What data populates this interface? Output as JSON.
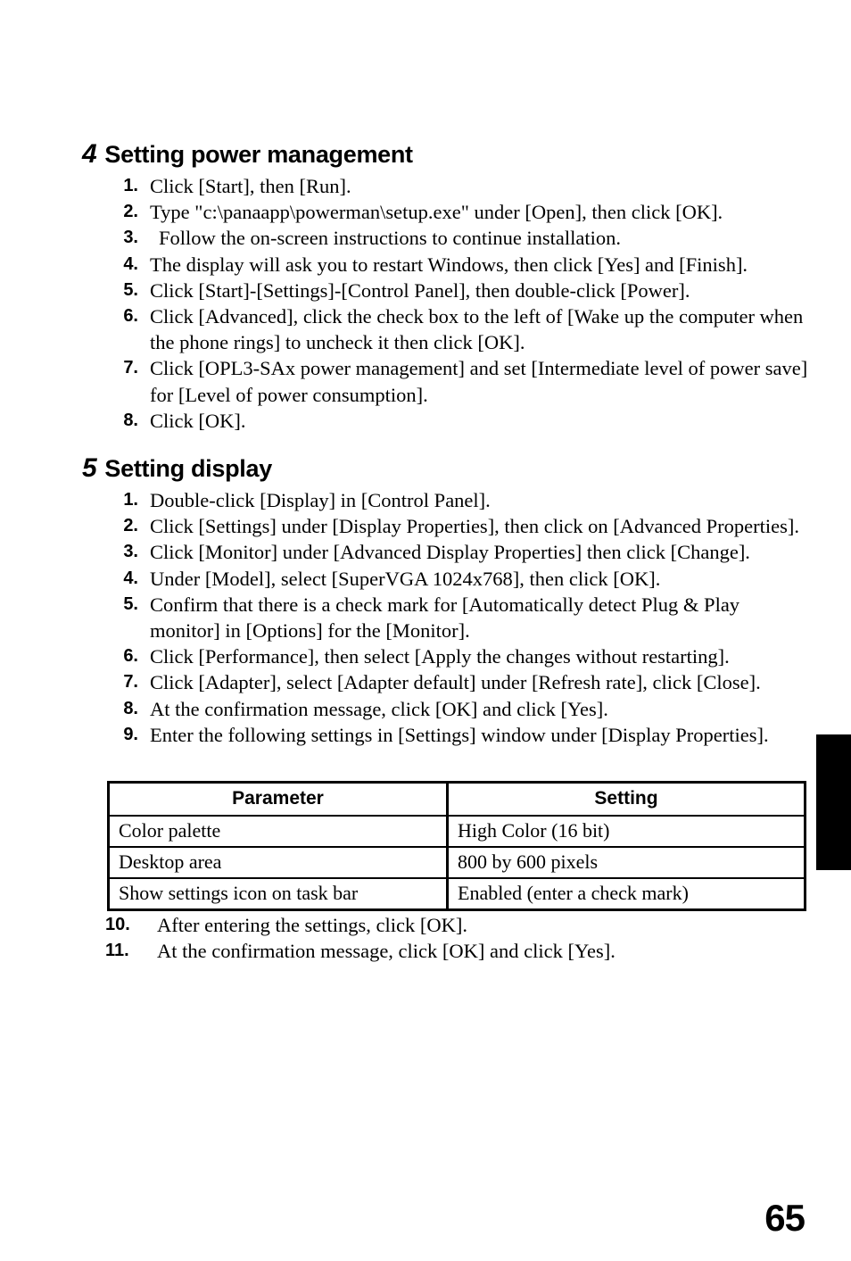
{
  "page": {
    "number": "65"
  },
  "sections": [
    {
      "number": "4",
      "title": "Setting power management",
      "steps": [
        {
          "num": "1.",
          "text": "Click [Start], then [Run]."
        },
        {
          "num": "2.",
          "text": "Type \"c:\\panaapp\\powerman\\setup.exe\" under [Open], then click [OK]."
        },
        {
          "num": "3.",
          "text": "Follow the on-screen instructions to continue installation."
        },
        {
          "num": "4.",
          "text": "The display will ask you to restart Windows, then click [Yes] and [Finish]."
        },
        {
          "num": "5.",
          "text": "Click [Start]-[Settings]-[Control Panel], then double-click [Power]."
        },
        {
          "num": "6.",
          "text": "Click [Advanced], click the check box to the left of [Wake up the computer when the phone rings] to uncheck it then click [OK]."
        },
        {
          "num": "7.",
          "text": "Click [OPL3-SAx power management] and set [Intermediate level of power save] for [Level of power consumption]."
        },
        {
          "num": "8.",
          "text": "Click [OK]."
        }
      ]
    },
    {
      "number": "5",
      "title": "Setting display",
      "steps": [
        {
          "num": "1.",
          "text": "Double-click [Display] in [Control Panel]."
        },
        {
          "num": "2.",
          "text": "Click [Settings] under [Display Properties], then click on [Advanced Properties]."
        },
        {
          "num": "3.",
          "text": "Click [Monitor] under [Advanced Display Properties] then click [Change]."
        },
        {
          "num": "4.",
          "text": "Under [Model], select [SuperVGA 1024x768], then click [OK]."
        },
        {
          "num": "5.",
          "text": "Confirm that there is a check mark for [Automatically detect Plug & Play monitor] in [Options] for the [Monitor]."
        },
        {
          "num": "6.",
          "text": "Click [Performance], then select [Apply the changes without restarting]."
        },
        {
          "num": "7.",
          "text": "Click [Adapter], select [Adapter default] under [Refresh rate], click [Close]."
        },
        {
          "num": "8.",
          "text": "At the confirmation message, click [OK] and click [Yes]."
        },
        {
          "num": "9.",
          "text": "Enter the following settings in [Settings] window under [Display Properties]."
        }
      ]
    }
  ],
  "settings_table": {
    "headers": [
      "Parameter",
      "Setting"
    ],
    "rows": [
      [
        "Color palette",
        "High Color (16 bit)"
      ],
      [
        "Desktop area",
        "800 by 600 pixels"
      ],
      [
        "Show settings icon on task bar",
        "Enabled (enter a check mark)"
      ]
    ]
  },
  "post_table_steps": [
    {
      "num": "10.",
      "text": "After entering the settings, click [OK]."
    },
    {
      "num": "11.",
      "text": "At the confirmation message, click [OK] and click [Yes]."
    }
  ]
}
